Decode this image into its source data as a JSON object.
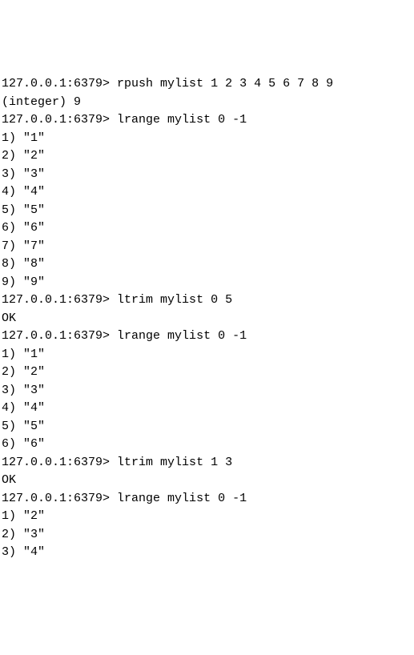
{
  "prompt": "127.0.0.1:6379>",
  "commands": [
    {
      "input": "rpush mylist 1 2 3 4 5 6 7 8 9",
      "output": [
        "(integer) 9"
      ]
    },
    {
      "input": "lrange mylist 0 -1",
      "output": [
        "1) \"1\"",
        "2) \"2\"",
        "3) \"3\"",
        "4) \"4\"",
        "5) \"5\"",
        "6) \"6\"",
        "7) \"7\"",
        "8) \"8\"",
        "9) \"9\""
      ]
    },
    {
      "input": "ltrim mylist 0 5",
      "output": [
        "OK"
      ]
    },
    {
      "input": "lrange mylist 0 -1",
      "output": [
        "1) \"1\"",
        "2) \"2\"",
        "3) \"3\"",
        "4) \"4\"",
        "5) \"5\"",
        "6) \"6\""
      ]
    },
    {
      "input": "ltrim mylist 1 3",
      "output": [
        "OK"
      ]
    },
    {
      "input": "lrange mylist 0 -1",
      "output": [
        "1) \"2\"",
        "2) \"3\"",
        "3) \"4\""
      ]
    }
  ]
}
